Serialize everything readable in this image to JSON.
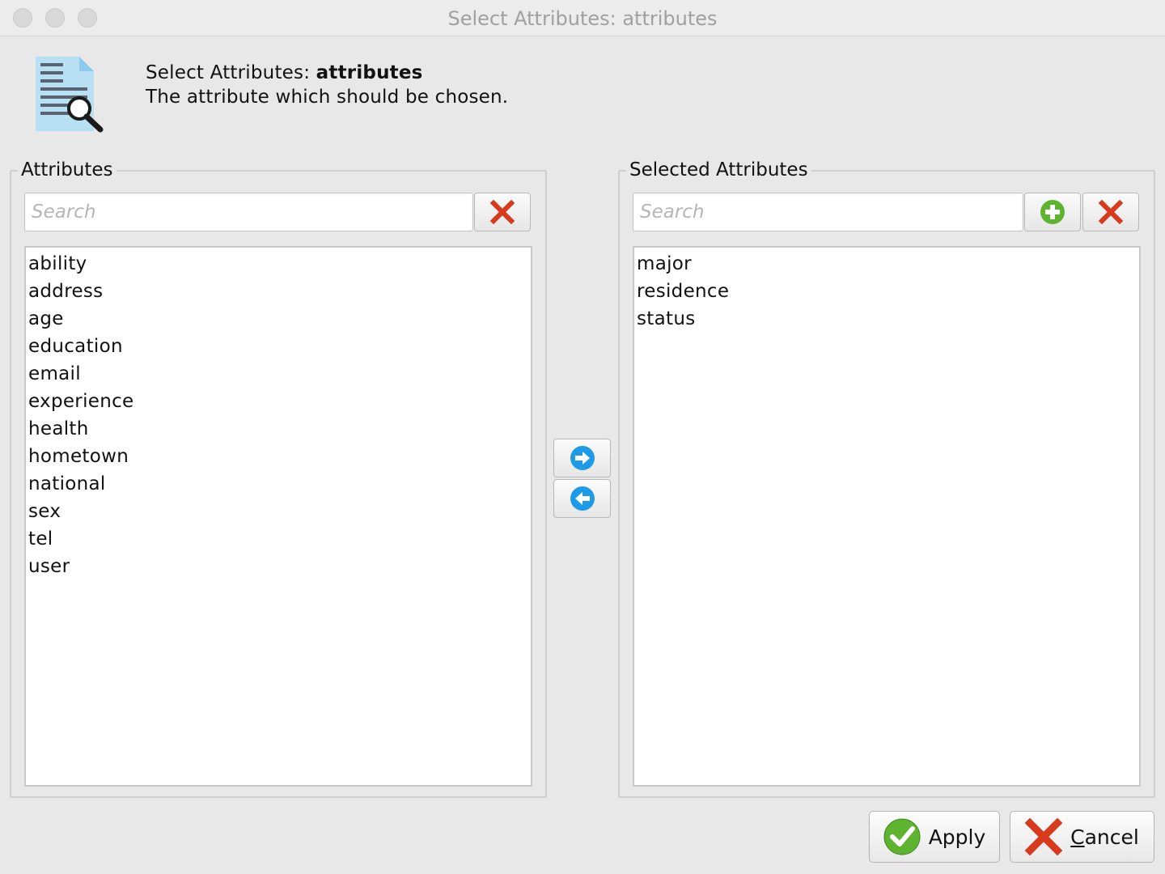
{
  "window": {
    "title": "Select Attributes: attributes"
  },
  "header": {
    "title_prefix": "Select Attributes:",
    "title_bold": "attributes",
    "description": "The attribute which should be chosen.",
    "icon": "document-search-icon"
  },
  "left_panel": {
    "legend": "Attributes",
    "search_placeholder": "Search",
    "search_value": "",
    "clear_icon": "red-x-icon",
    "items": [
      "ability",
      "address",
      "age",
      "education",
      "email",
      "experience",
      "health",
      "hometown",
      "national",
      "sex",
      "tel",
      "user"
    ]
  },
  "right_panel": {
    "legend": "Selected Attributes",
    "search_placeholder": "Search",
    "search_value": "",
    "add_icon": "green-plus-icon",
    "clear_icon": "red-x-icon",
    "items": [
      "major",
      "residence",
      "status"
    ]
  },
  "transfer": {
    "right_icon": "arrow-right-icon",
    "left_icon": "arrow-left-icon"
  },
  "footer": {
    "apply_label": "Apply",
    "cancel_first": "C",
    "cancel_rest": "ancel"
  },
  "colors": {
    "check_green": "#5fb42f",
    "x_red": "#d93a1e",
    "arrow_blue": "#1e9be6"
  }
}
